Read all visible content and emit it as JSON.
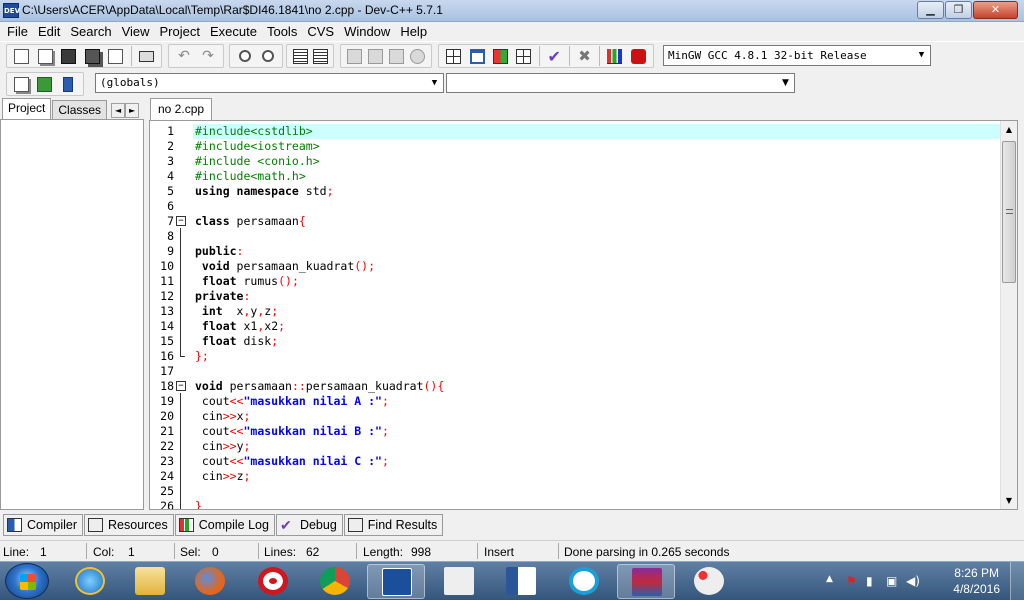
{
  "window": {
    "title": "C:\\Users\\ACER\\AppData\\Local\\Temp\\Rar$DI46.1841\\no 2.cpp - Dev-C++ 5.7.1",
    "app_icon_text": "DEV"
  },
  "menu": [
    "File",
    "Edit",
    "Search",
    "View",
    "Project",
    "Execute",
    "Tools",
    "CVS",
    "Window",
    "Help"
  ],
  "toolbar": {
    "compiler": "MinGW GCC 4.8.1 32-bit Release",
    "scope": "(globals)",
    "members": ""
  },
  "left_panel": {
    "tabs": [
      "Project",
      "Classes"
    ],
    "arrows": [
      "◄",
      "►"
    ]
  },
  "editor": {
    "file_tab": "no 2.cpp",
    "lines": [
      {
        "n": "1",
        "segs": [
          {
            "t": "#include<cstdlib>",
            "c": "pp"
          }
        ]
      },
      {
        "n": "2",
        "segs": [
          {
            "t": "#include<iostream>",
            "c": "pp"
          }
        ]
      },
      {
        "n": "3",
        "segs": [
          {
            "t": "#include <conio.h>",
            "c": "pp"
          }
        ]
      },
      {
        "n": "4",
        "segs": [
          {
            "t": "#include<math.h>",
            "c": "pp"
          }
        ]
      },
      {
        "n": "5",
        "segs": [
          {
            "t": "using namespace ",
            "c": "kw"
          },
          {
            "t": "std",
            "c": "plain"
          },
          {
            "t": ";",
            "c": "sym"
          }
        ]
      },
      {
        "n": "6",
        "segs": []
      },
      {
        "n": "7",
        "segs": [
          {
            "t": "class ",
            "c": "kw"
          },
          {
            "t": "persamaan",
            "c": "plain"
          },
          {
            "t": "{",
            "c": "sym"
          }
        ]
      },
      {
        "n": "8",
        "segs": []
      },
      {
        "n": "9",
        "segs": [
          {
            "t": "public",
            "c": "kw"
          },
          {
            "t": ":",
            "c": "sym"
          }
        ]
      },
      {
        "n": "10",
        "segs": [
          {
            "t": " void ",
            "c": "kw"
          },
          {
            "t": "persamaan_kuadrat",
            "c": "plain"
          },
          {
            "t": "();",
            "c": "sym"
          }
        ]
      },
      {
        "n": "11",
        "segs": [
          {
            "t": " float ",
            "c": "kw"
          },
          {
            "t": "rumus",
            "c": "plain"
          },
          {
            "t": "();",
            "c": "sym"
          }
        ]
      },
      {
        "n": "12",
        "segs": [
          {
            "t": "private",
            "c": "kw"
          },
          {
            "t": ":",
            "c": "sym"
          }
        ]
      },
      {
        "n": "13",
        "segs": [
          {
            "t": " int  ",
            "c": "kw"
          },
          {
            "t": "x",
            "c": "plain"
          },
          {
            "t": ",",
            "c": "sym"
          },
          {
            "t": "y",
            "c": "plain"
          },
          {
            "t": ",",
            "c": "sym"
          },
          {
            "t": "z",
            "c": "plain"
          },
          {
            "t": ";",
            "c": "sym"
          }
        ]
      },
      {
        "n": "14",
        "segs": [
          {
            "t": " float ",
            "c": "kw"
          },
          {
            "t": "x1",
            "c": "plain"
          },
          {
            "t": ",",
            "c": "sym"
          },
          {
            "t": "x2",
            "c": "plain"
          },
          {
            "t": ";",
            "c": "sym"
          }
        ]
      },
      {
        "n": "15",
        "segs": [
          {
            "t": " float ",
            "c": "kw"
          },
          {
            "t": "disk",
            "c": "plain"
          },
          {
            "t": ";",
            "c": "sym"
          }
        ]
      },
      {
        "n": "16",
        "segs": [
          {
            "t": "};",
            "c": "sym"
          }
        ]
      },
      {
        "n": "17",
        "segs": []
      },
      {
        "n": "18",
        "segs": [
          {
            "t": "void ",
            "c": "kw"
          },
          {
            "t": "persamaan",
            "c": "plain"
          },
          {
            "t": "::",
            "c": "sym"
          },
          {
            "t": "persamaan_kuadrat",
            "c": "plain"
          },
          {
            "t": "(){",
            "c": "sym"
          }
        ]
      },
      {
        "n": "19",
        "segs": [
          {
            "t": " cout",
            "c": "plain"
          },
          {
            "t": "<<",
            "c": "sym"
          },
          {
            "t": "\"masukkan nilai A :\"",
            "c": "str"
          },
          {
            "t": ";",
            "c": "sym"
          }
        ]
      },
      {
        "n": "20",
        "segs": [
          {
            "t": " cin",
            "c": "plain"
          },
          {
            "t": ">>",
            "c": "sym"
          },
          {
            "t": "x",
            "c": "plain"
          },
          {
            "t": ";",
            "c": "sym"
          }
        ]
      },
      {
        "n": "21",
        "segs": [
          {
            "t": " cout",
            "c": "plain"
          },
          {
            "t": "<<",
            "c": "sym"
          },
          {
            "t": "\"masukkan nilai B :\"",
            "c": "str"
          },
          {
            "t": ";",
            "c": "sym"
          }
        ]
      },
      {
        "n": "22",
        "segs": [
          {
            "t": " cin",
            "c": "plain"
          },
          {
            "t": ">>",
            "c": "sym"
          },
          {
            "t": "y",
            "c": "plain"
          },
          {
            "t": ";",
            "c": "sym"
          }
        ]
      },
      {
        "n": "23",
        "segs": [
          {
            "t": " cout",
            "c": "plain"
          },
          {
            "t": "<<",
            "c": "sym"
          },
          {
            "t": "\"masukkan nilai C :\"",
            "c": "str"
          },
          {
            "t": ";",
            "c": "sym"
          }
        ]
      },
      {
        "n": "24",
        "segs": [
          {
            "t": " cin",
            "c": "plain"
          },
          {
            "t": ">>",
            "c": "sym"
          },
          {
            "t": "z",
            "c": "plain"
          },
          {
            "t": ";",
            "c": "sym"
          }
        ]
      },
      {
        "n": "25",
        "segs": []
      },
      {
        "n": "26",
        "segs": [
          {
            "t": "}",
            "c": "sym"
          }
        ]
      }
    ]
  },
  "bottom_tabs": [
    "Compiler",
    "Resources",
    "Compile Log",
    "Debug",
    "Find Results"
  ],
  "status": {
    "line_label": "Line:",
    "line_value": "1",
    "col_label": "Col:",
    "col_value": "1",
    "sel_label": "Sel:",
    "sel_value": "0",
    "lines_label": "Lines:",
    "lines_value": "62",
    "length_label": "Length:",
    "length_value": "998",
    "mode": "Insert",
    "message": "Done parsing in 0.265 seconds"
  },
  "taskbar": {
    "apps": [
      "internet-explorer",
      "file-explorer",
      "firefox",
      "opera",
      "chrome",
      "dev-cpp",
      "dinosaur-app",
      "word",
      "audio-app",
      "winrar",
      "paint"
    ],
    "active_app": "dev-cpp",
    "time": "8:26 PM",
    "date": "4/8/2016"
  },
  "colors": {
    "preprocessor": "#008000",
    "symbol": "#ff0000",
    "string": "#0000ff",
    "current_line": "#ccffff"
  }
}
